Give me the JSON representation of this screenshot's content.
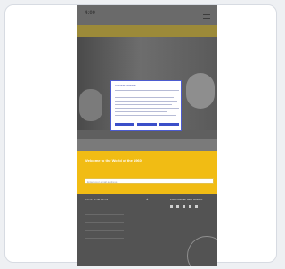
{
  "phone": {
    "logo_text": "4:00",
    "menu_icon": "menu-icon",
    "nav_text": "",
    "modal": {
      "title": "COOKIE NOTICE",
      "buttons": [
        "",
        "",
        ""
      ]
    },
    "yellow_section": {
      "heading": "Welcome to the World of the 1960",
      "subtext": "",
      "input_placeholder": "Enter your email address"
    },
    "footer": {
      "nav_title": "Select: North Island",
      "social_title": "FOLLOW ME ON LOOPTY",
      "items": [
        "",
        "",
        "",
        ""
      ],
      "bottom_text": "",
      "right_bottom_text": ""
    }
  }
}
